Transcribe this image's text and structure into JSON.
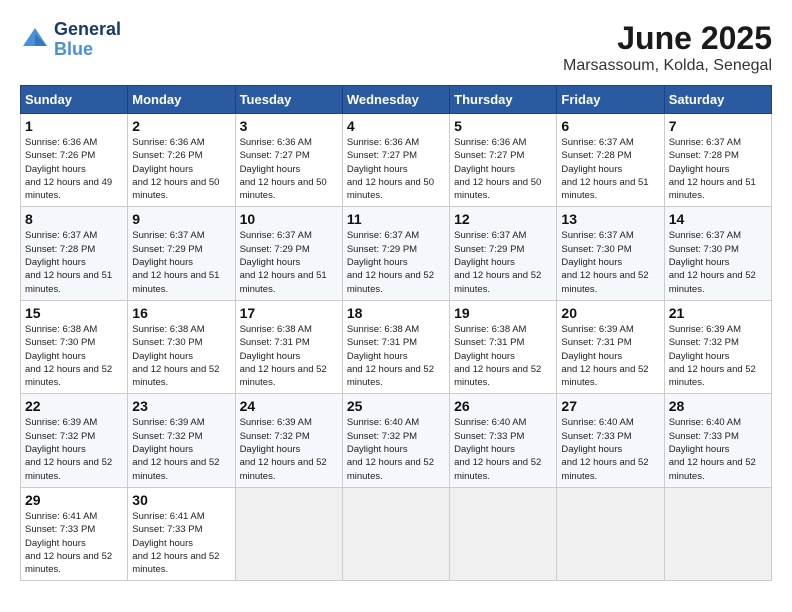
{
  "logo": {
    "line1": "General",
    "line2": "Blue"
  },
  "title": "June 2025",
  "subtitle": "Marsassoum, Kolda, Senegal",
  "weekdays": [
    "Sunday",
    "Monday",
    "Tuesday",
    "Wednesday",
    "Thursday",
    "Friday",
    "Saturday"
  ],
  "weeks": [
    [
      {
        "day": 1,
        "rise": "6:36 AM",
        "set": "7:26 PM",
        "hours": "12 hours and 49 minutes."
      },
      {
        "day": 2,
        "rise": "6:36 AM",
        "set": "7:26 PM",
        "hours": "12 hours and 50 minutes."
      },
      {
        "day": 3,
        "rise": "6:36 AM",
        "set": "7:27 PM",
        "hours": "12 hours and 50 minutes."
      },
      {
        "day": 4,
        "rise": "6:36 AM",
        "set": "7:27 PM",
        "hours": "12 hours and 50 minutes."
      },
      {
        "day": 5,
        "rise": "6:36 AM",
        "set": "7:27 PM",
        "hours": "12 hours and 50 minutes."
      },
      {
        "day": 6,
        "rise": "6:37 AM",
        "set": "7:28 PM",
        "hours": "12 hours and 51 minutes."
      },
      {
        "day": 7,
        "rise": "6:37 AM",
        "set": "7:28 PM",
        "hours": "12 hours and 51 minutes."
      }
    ],
    [
      {
        "day": 8,
        "rise": "6:37 AM",
        "set": "7:28 PM",
        "hours": "12 hours and 51 minutes."
      },
      {
        "day": 9,
        "rise": "6:37 AM",
        "set": "7:29 PM",
        "hours": "12 hours and 51 minutes."
      },
      {
        "day": 10,
        "rise": "6:37 AM",
        "set": "7:29 PM",
        "hours": "12 hours and 51 minutes."
      },
      {
        "day": 11,
        "rise": "6:37 AM",
        "set": "7:29 PM",
        "hours": "12 hours and 52 minutes."
      },
      {
        "day": 12,
        "rise": "6:37 AM",
        "set": "7:29 PM",
        "hours": "12 hours and 52 minutes."
      },
      {
        "day": 13,
        "rise": "6:37 AM",
        "set": "7:30 PM",
        "hours": "12 hours and 52 minutes."
      },
      {
        "day": 14,
        "rise": "6:37 AM",
        "set": "7:30 PM",
        "hours": "12 hours and 52 minutes."
      }
    ],
    [
      {
        "day": 15,
        "rise": "6:38 AM",
        "set": "7:30 PM",
        "hours": "12 hours and 52 minutes."
      },
      {
        "day": 16,
        "rise": "6:38 AM",
        "set": "7:30 PM",
        "hours": "12 hours and 52 minutes."
      },
      {
        "day": 17,
        "rise": "6:38 AM",
        "set": "7:31 PM",
        "hours": "12 hours and 52 minutes."
      },
      {
        "day": 18,
        "rise": "6:38 AM",
        "set": "7:31 PM",
        "hours": "12 hours and 52 minutes."
      },
      {
        "day": 19,
        "rise": "6:38 AM",
        "set": "7:31 PM",
        "hours": "12 hours and 52 minutes."
      },
      {
        "day": 20,
        "rise": "6:39 AM",
        "set": "7:31 PM",
        "hours": "12 hours and 52 minutes."
      },
      {
        "day": 21,
        "rise": "6:39 AM",
        "set": "7:32 PM",
        "hours": "12 hours and 52 minutes."
      }
    ],
    [
      {
        "day": 22,
        "rise": "6:39 AM",
        "set": "7:32 PM",
        "hours": "12 hours and 52 minutes."
      },
      {
        "day": 23,
        "rise": "6:39 AM",
        "set": "7:32 PM",
        "hours": "12 hours and 52 minutes."
      },
      {
        "day": 24,
        "rise": "6:39 AM",
        "set": "7:32 PM",
        "hours": "12 hours and 52 minutes."
      },
      {
        "day": 25,
        "rise": "6:40 AM",
        "set": "7:32 PM",
        "hours": "12 hours and 52 minutes."
      },
      {
        "day": 26,
        "rise": "6:40 AM",
        "set": "7:33 PM",
        "hours": "12 hours and 52 minutes."
      },
      {
        "day": 27,
        "rise": "6:40 AM",
        "set": "7:33 PM",
        "hours": "12 hours and 52 minutes."
      },
      {
        "day": 28,
        "rise": "6:40 AM",
        "set": "7:33 PM",
        "hours": "12 hours and 52 minutes."
      }
    ],
    [
      {
        "day": 29,
        "rise": "6:41 AM",
        "set": "7:33 PM",
        "hours": "12 hours and 52 minutes."
      },
      {
        "day": 30,
        "rise": "6:41 AM",
        "set": "7:33 PM",
        "hours": "12 hours and 52 minutes."
      },
      null,
      null,
      null,
      null,
      null
    ]
  ]
}
